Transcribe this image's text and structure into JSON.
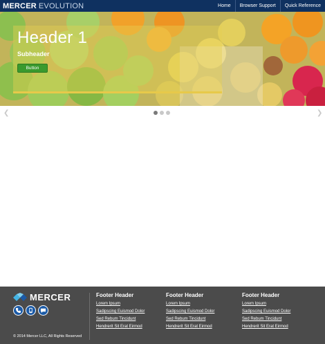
{
  "header": {
    "brand_bold": "MERCER",
    "brand_light": "EVOLUTION",
    "nav": [
      "Home",
      "Browser Support",
      "Quick Reference"
    ]
  },
  "hero": {
    "title": "Header 1",
    "subheader": "Subheader",
    "button_label": "Button"
  },
  "carousel": {
    "prev_icon": "chevron-left-icon",
    "next_icon": "chevron-right-icon",
    "slide_count": 3,
    "active_slide": 1
  },
  "footer": {
    "logo_text": "MERCER",
    "icons": [
      "phone-icon",
      "mail-icon",
      "chat-icon"
    ],
    "copyright": "© 2014 Mercer LLC, All Rights Reserved",
    "columns": [
      {
        "header": "Footer Header",
        "links": [
          "Lorem Ipsum",
          "Sadipscing Euismod Dolor",
          "Sed Rebum Tincidunt",
          "Hendrerit Sit Erat Eirmod"
        ]
      },
      {
        "header": "Footer Header",
        "links": [
          "Lorem Ipsum",
          "Sadipscing Euismod Dolor",
          "Sed Rebum Tincidunt",
          "Hendrerit Sit Erat Eirmod"
        ]
      },
      {
        "header": "Footer Header",
        "links": [
          "Lorem Ipsum",
          "Sadipscing Euismod Dolor",
          "Sed Rebum Tincidunt",
          "Hendrerit Sit Erat Eirmod"
        ]
      }
    ]
  },
  "colors": {
    "topbar": "#0f3160",
    "footer": "#4b4b4b",
    "button": "#3a9a2e",
    "accent": "#1b5aa6"
  }
}
